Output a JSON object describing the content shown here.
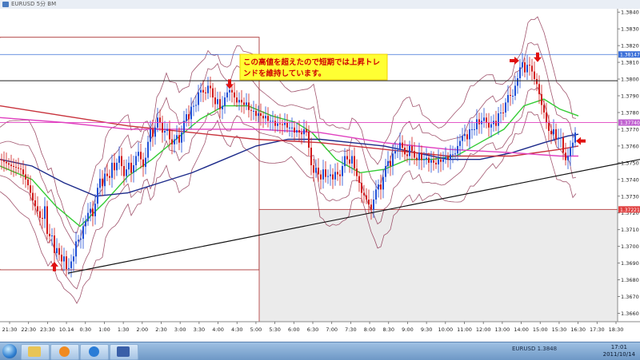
{
  "window": {
    "title": "EURUSD 5分 BM"
  },
  "annotation": {
    "line1": "この高値を超えたので短期では上昇トレ",
    "line2": "ンドを維持しています。"
  },
  "price_tags": {
    "upper": "1.38147",
    "current": "1.37740",
    "lower": "1.37221"
  },
  "colors": {
    "bull": "#1f4fd6",
    "bear": "#d11a1a",
    "ma_green": "#33cc33",
    "ma_navy": "#1c2a8a",
    "ma_red": "#c8323c",
    "ma_magenta": "#e040c0",
    "bollinger": "#8a2a4a",
    "arrow": "#e01010",
    "annotation_bg": "#ffff33",
    "annotation_text": "#d00000",
    "tag_upper": "#3b6fd8",
    "tag_current": "#c060d0",
    "tag_lower": "#e04040"
  },
  "taskbar": {
    "icons": [
      "start-orb-icon",
      "explorer-icon",
      "media-player-icon",
      "internet-explorer-icon",
      "app-shield-icon"
    ],
    "tray_label": "EURUSD 1.3848",
    "clock_time": "17:01",
    "clock_date": "2011/10/14"
  },
  "chart_data": {
    "type": "candlestick",
    "instrument": "EURUSD",
    "timeframe": "5分",
    "ylim": [
      1.3655,
      1.3842
    ],
    "y_ticks": [
      "1.3840",
      "1.3830",
      "1.3820",
      "1.3810",
      "1.3800",
      "1.3790",
      "1.3780",
      "1.3770",
      "1.3760",
      "1.3750",
      "1.3740",
      "1.3730",
      "1.3720",
      "1.3710",
      "1.3700",
      "1.3690",
      "1.3680",
      "1.3670",
      "1.3660"
    ],
    "x_ticks": [
      "21:30",
      "22:30",
      "23:30",
      "10.14",
      "0:30",
      "1:00",
      "1:30",
      "2:00",
      "2:30",
      "3:00",
      "3:30",
      "4:00",
      "4:30",
      "5:00",
      "5:30",
      "6:00",
      "6:30",
      "7:00",
      "7:30",
      "8:00",
      "8:30",
      "9:00",
      "9:30",
      "10:00",
      "11:00",
      "12:00",
      "13:00",
      "14:00",
      "15:00",
      "15:30",
      "16:30",
      "17:30",
      "18:30"
    ],
    "key_prices": [
      {
        "label": "upper",
        "price": 1.38147
      },
      {
        "label": "resistance",
        "price": 1.3799
      },
      {
        "label": "current",
        "price": 1.3774
      },
      {
        "label": "lower",
        "price": 1.37221
      }
    ],
    "path": [
      [
        0,
        1.3752
      ],
      [
        14,
        1.3748
      ],
      [
        26,
        1.3746
      ],
      [
        34,
        1.3738
      ],
      [
        42,
        1.3726
      ],
      [
        48,
        1.372
      ],
      [
        52,
        1.3714
      ],
      [
        56,
        1.3724
      ],
      [
        60,
        1.3702
      ],
      [
        64,
        1.371
      ],
      [
        68,
        1.3696
      ],
      [
        72,
        1.37
      ],
      [
        76,
        1.369
      ],
      [
        80,
        1.3694
      ],
      [
        84,
        1.3684
      ],
      [
        88,
        1.369
      ],
      [
        92,
        1.3694
      ],
      [
        96,
        1.3706
      ],
      [
        100,
        1.3702
      ],
      [
        104,
        1.3712
      ],
      [
        108,
        1.3716
      ],
      [
        112,
        1.3724
      ],
      [
        116,
        1.3718
      ],
      [
        120,
        1.3728
      ],
      [
        124,
        1.3742
      ],
      [
        128,
        1.3736
      ],
      [
        132,
        1.3746
      ],
      [
        136,
        1.3738
      ],
      [
        140,
        1.375
      ],
      [
        144,
        1.3744
      ],
      [
        148,
        1.3756
      ],
      [
        152,
        1.3748
      ],
      [
        156,
        1.374
      ],
      [
        160,
        1.3752
      ],
      [
        164,
        1.3744
      ],
      [
        168,
        1.375
      ],
      [
        172,
        1.3758
      ],
      [
        176,
        1.3752
      ],
      [
        180,
        1.3746
      ],
      [
        184,
        1.376
      ],
      [
        188,
        1.377
      ],
      [
        192,
        1.3764
      ],
      [
        196,
        1.3778
      ],
      [
        200,
        1.3774
      ],
      [
        204,
        1.3766
      ],
      [
        208,
        1.3772
      ],
      [
        212,
        1.3764
      ],
      [
        216,
        1.376
      ],
      [
        220,
        1.3768
      ],
      [
        224,
        1.3762
      ],
      [
        228,
        1.377
      ],
      [
        232,
        1.378
      ],
      [
        236,
        1.3776
      ],
      [
        240,
        1.3786
      ],
      [
        244,
        1.3782
      ],
      [
        248,
        1.3792
      ],
      [
        252,
        1.3794
      ],
      [
        256,
        1.379
      ],
      [
        260,
        1.3796
      ],
      [
        264,
        1.3794
      ],
      [
        268,
        1.3784
      ],
      [
        272,
        1.3788
      ],
      [
        276,
        1.378
      ],
      [
        280,
        1.3788
      ],
      [
        284,
        1.3792
      ],
      [
        288,
        1.3794
      ],
      [
        292,
        1.379
      ],
      [
        296,
        1.3786
      ],
      [
        300,
        1.3788
      ],
      [
        304,
        1.3784
      ],
      [
        308,
        1.3786
      ],
      [
        312,
        1.378
      ],
      [
        316,
        1.3782
      ],
      [
        320,
        1.3778
      ],
      [
        324,
        1.378
      ],
      [
        328,
        1.3776
      ],
      [
        332,
        1.3778
      ],
      [
        336,
        1.3774
      ],
      [
        340,
        1.3776
      ],
      [
        344,
        1.3772
      ],
      [
        348,
        1.3774
      ],
      [
        352,
        1.3772
      ],
      [
        356,
        1.3774
      ],
      [
        360,
        1.377
      ],
      [
        364,
        1.3772
      ],
      [
        368,
        1.3768
      ],
      [
        372,
        1.377
      ],
      [
        376,
        1.3766
      ],
      [
        380,
        1.377
      ],
      [
        384,
        1.3768
      ],
      [
        388,
        1.375
      ],
      [
        392,
        1.3744
      ],
      [
        396,
        1.3748
      ],
      [
        400,
        1.3738
      ],
      [
        404,
        1.3746
      ],
      [
        408,
        1.374
      ],
      [
        412,
        1.3744
      ],
      [
        416,
        1.374
      ],
      [
        420,
        1.3746
      ],
      [
        424,
        1.374
      ],
      [
        428,
        1.3748
      ],
      [
        432,
        1.3756
      ],
      [
        436,
        1.3748
      ],
      [
        440,
        1.3754
      ],
      [
        444,
        1.3744
      ],
      [
        448,
        1.374
      ],
      [
        452,
        1.3732
      ],
      [
        456,
        1.373
      ],
      [
        460,
        1.3726
      ],
      [
        464,
        1.3722
      ],
      [
        468,
        1.373
      ],
      [
        472,
        1.3738
      ],
      [
        476,
        1.3734
      ],
      [
        480,
        1.3744
      ],
      [
        484,
        1.3752
      ],
      [
        488,
        1.3748
      ],
      [
        492,
        1.3758
      ],
      [
        496,
        1.3756
      ],
      [
        500,
        1.3762
      ],
      [
        504,
        1.3758
      ],
      [
        508,
        1.3752
      ],
      [
        512,
        1.376
      ],
      [
        516,
        1.3756
      ],
      [
        520,
        1.375
      ],
      [
        524,
        1.3756
      ],
      [
        528,
        1.375
      ],
      [
        532,
        1.3754
      ],
      [
        536,
        1.375
      ],
      [
        540,
        1.3752
      ],
      [
        544,
        1.3748
      ],
      [
        548,
        1.3752
      ],
      [
        552,
        1.375
      ],
      [
        556,
        1.3754
      ],
      [
        560,
        1.3752
      ],
      [
        564,
        1.3756
      ],
      [
        568,
        1.3754
      ],
      [
        572,
        1.376
      ],
      [
        576,
        1.3764
      ],
      [
        580,
        1.3768
      ],
      [
        584,
        1.3764
      ],
      [
        588,
        1.3772
      ],
      [
        592,
        1.3768
      ],
      [
        596,
        1.3776
      ],
      [
        600,
        1.3772
      ],
      [
        604,
        1.3778
      ],
      [
        608,
        1.3774
      ],
      [
        612,
        1.377
      ],
      [
        616,
        1.3776
      ],
      [
        620,
        1.3772
      ],
      [
        624,
        1.3782
      ],
      [
        628,
        1.3778
      ],
      [
        632,
        1.3786
      ],
      [
        636,
        1.3792
      ],
      [
        640,
        1.3788
      ],
      [
        644,
        1.3796
      ],
      [
        648,
        1.3802
      ],
      [
        652,
        1.3812
      ],
      [
        656,
        1.3804
      ],
      [
        660,
        1.381
      ],
      [
        664,
        1.3806
      ],
      [
        668,
        1.38
      ],
      [
        672,
        1.3796
      ],
      [
        676,
        1.3786
      ],
      [
        680,
        1.378
      ],
      [
        684,
        1.3772
      ],
      [
        688,
        1.3766
      ],
      [
        692,
        1.377
      ],
      [
        696,
        1.3762
      ],
      [
        700,
        1.3768
      ],
      [
        704,
        1.3756
      ],
      [
        708,
        1.375
      ],
      [
        712,
        1.3758
      ],
      [
        716,
        1.3762
      ],
      [
        720,
        1.377
      ],
      [
        723,
        1.3774
      ]
    ],
    "moving_averages": [
      {
        "color": "ma_green",
        "points": [
          [
            0,
            1.3748
          ],
          [
            40,
            1.374
          ],
          [
            70,
            1.3724
          ],
          [
            100,
            1.3712
          ],
          [
            130,
            1.3726
          ],
          [
            160,
            1.3742
          ],
          [
            190,
            1.3752
          ],
          [
            220,
            1.3764
          ],
          [
            250,
            1.3776
          ],
          [
            280,
            1.3784
          ],
          [
            310,
            1.3784
          ],
          [
            340,
            1.3778
          ],
          [
            370,
            1.3774
          ],
          [
            390,
            1.3768
          ],
          [
            420,
            1.3752
          ],
          [
            450,
            1.3744
          ],
          [
            480,
            1.3746
          ],
          [
            510,
            1.3752
          ],
          [
            540,
            1.3752
          ],
          [
            570,
            1.3754
          ],
          [
            600,
            1.3762
          ],
          [
            630,
            1.377
          ],
          [
            655,
            1.3784
          ],
          [
            680,
            1.3788
          ],
          [
            700,
            1.3782
          ],
          [
            723,
            1.3778
          ]
        ]
      },
      {
        "color": "ma_navy",
        "points": [
          [
            0,
            1.3752
          ],
          [
            40,
            1.3748
          ],
          [
            80,
            1.3738
          ],
          [
            120,
            1.373
          ],
          [
            160,
            1.3732
          ],
          [
            200,
            1.3738
          ],
          [
            240,
            1.3744
          ],
          [
            280,
            1.3752
          ],
          [
            320,
            1.376
          ],
          [
            360,
            1.3764
          ],
          [
            400,
            1.3764
          ],
          [
            440,
            1.3762
          ],
          [
            480,
            1.376
          ],
          [
            520,
            1.3756
          ],
          [
            560,
            1.3752
          ],
          [
            600,
            1.3752
          ],
          [
            640,
            1.3756
          ],
          [
            680,
            1.3762
          ],
          [
            710,
            1.3766
          ],
          [
            723,
            1.3767
          ]
        ]
      },
      {
        "color": "ma_red",
        "points": [
          [
            0,
            1.3784
          ],
          [
            80,
            1.3778
          ],
          [
            160,
            1.3772
          ],
          [
            240,
            1.3768
          ],
          [
            320,
            1.3764
          ],
          [
            400,
            1.3762
          ],
          [
            480,
            1.3758
          ],
          [
            560,
            1.3754
          ],
          [
            640,
            1.3754
          ],
          [
            700,
            1.3758
          ],
          [
            723,
            1.376
          ]
        ]
      },
      {
        "color": "ma_magenta",
        "points": [
          [
            0,
            1.3777
          ],
          [
            80,
            1.3774
          ],
          [
            160,
            1.377
          ],
          [
            240,
            1.377
          ],
          [
            320,
            1.377
          ],
          [
            400,
            1.3768
          ],
          [
            480,
            1.3762
          ],
          [
            560,
            1.3758
          ],
          [
            640,
            1.3756
          ],
          [
            700,
            1.3754
          ],
          [
            723,
            1.3754
          ]
        ]
      }
    ],
    "trendline": [
      [
        85,
        1.3684
      ],
      [
        800,
        1.3752
      ]
    ],
    "arrows": [
      {
        "x": 68,
        "price": 1.3688,
        "direction": "up"
      },
      {
        "x": 287,
        "price": 1.3797,
        "direction": "down"
      },
      {
        "x": 643,
        "price": 1.3811,
        "direction": "right"
      },
      {
        "x": 672,
        "price": 1.3813,
        "direction": "down"
      },
      {
        "x": 726,
        "price": 1.3763,
        "direction": "left"
      }
    ]
  }
}
